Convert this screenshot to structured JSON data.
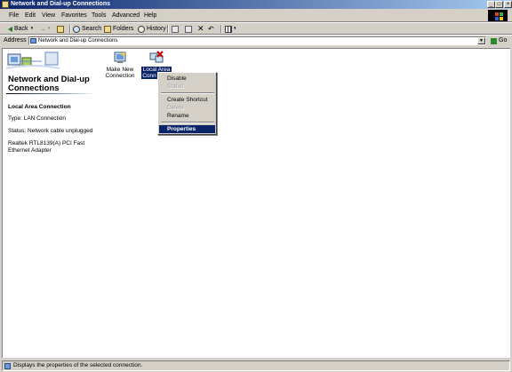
{
  "window": {
    "title": "Network and Dial-up Connections",
    "buttons": {
      "minimize": "_",
      "maximize": "□",
      "close": "×"
    }
  },
  "menu": [
    "File",
    "Edit",
    "View",
    "Favorites",
    "Tools",
    "Advanced",
    "Help"
  ],
  "toolbar": {
    "back": "Back",
    "search": "Search",
    "folders": "Folders",
    "history": "History"
  },
  "address": {
    "label": "Address",
    "value": "Network and Dial-up Connections",
    "go": "Go"
  },
  "left_panel": {
    "title": "Network and Dial-up Connections",
    "selected_name": "Local Area Connection",
    "type": "Type: LAN Connection",
    "status": "Status: Network cable unplugged",
    "adapter": "Realtek RTL8139(A) PCI Fast Ethernet Adapter"
  },
  "icons": [
    {
      "label_line1": "Make New",
      "label_line2": "Connection"
    },
    {
      "label_line1": "Local Area",
      "label_line2": "Conn"
    }
  ],
  "context_menu": {
    "items": [
      {
        "label": "Disable",
        "enabled": true
      },
      {
        "label": "Status",
        "enabled": false
      },
      {
        "label": "Create Shortcut",
        "enabled": true
      },
      {
        "label": "Delete",
        "enabled": false
      },
      {
        "label": "Rename",
        "enabled": true
      },
      {
        "label": "Properties",
        "enabled": true,
        "highlighted": true
      }
    ]
  },
  "statusbar": {
    "text": "Displays the properties of the selected connection."
  },
  "colors": {
    "titlebar_start": "#0a246a",
    "titlebar_end": "#a6caf0",
    "face": "#d4d0c8",
    "highlight": "#0a246a"
  }
}
